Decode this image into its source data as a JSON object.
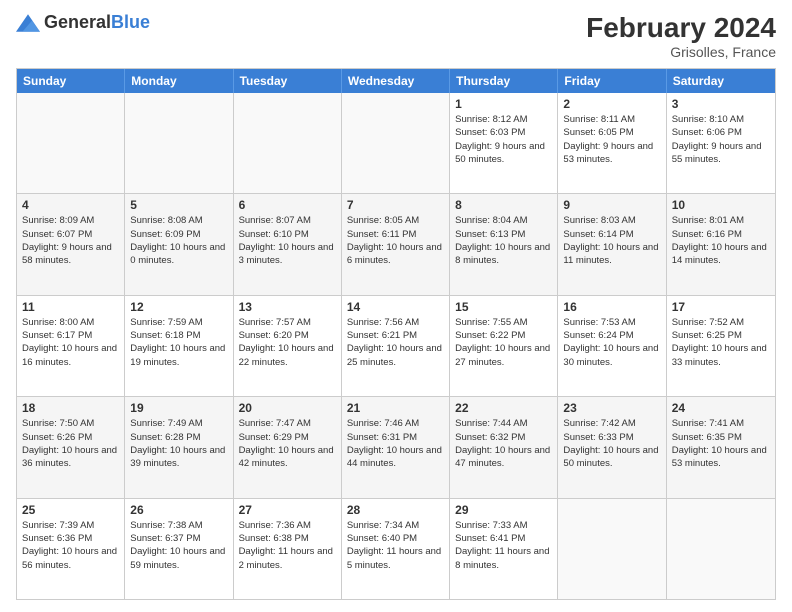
{
  "header": {
    "logo_general": "General",
    "logo_blue": "Blue",
    "month_year": "February 2024",
    "location": "Grisolles, France"
  },
  "days_of_week": [
    "Sunday",
    "Monday",
    "Tuesday",
    "Wednesday",
    "Thursday",
    "Friday",
    "Saturday"
  ],
  "weeks": [
    [
      {
        "day": "",
        "info": ""
      },
      {
        "day": "",
        "info": ""
      },
      {
        "day": "",
        "info": ""
      },
      {
        "day": "",
        "info": ""
      },
      {
        "day": "1",
        "info": "Sunrise: 8:12 AM\nSunset: 6:03 PM\nDaylight: 9 hours and 50 minutes."
      },
      {
        "day": "2",
        "info": "Sunrise: 8:11 AM\nSunset: 6:05 PM\nDaylight: 9 hours and 53 minutes."
      },
      {
        "day": "3",
        "info": "Sunrise: 8:10 AM\nSunset: 6:06 PM\nDaylight: 9 hours and 55 minutes."
      }
    ],
    [
      {
        "day": "4",
        "info": "Sunrise: 8:09 AM\nSunset: 6:07 PM\nDaylight: 9 hours and 58 minutes."
      },
      {
        "day": "5",
        "info": "Sunrise: 8:08 AM\nSunset: 6:09 PM\nDaylight: 10 hours and 0 minutes."
      },
      {
        "day": "6",
        "info": "Sunrise: 8:07 AM\nSunset: 6:10 PM\nDaylight: 10 hours and 3 minutes."
      },
      {
        "day": "7",
        "info": "Sunrise: 8:05 AM\nSunset: 6:11 PM\nDaylight: 10 hours and 6 minutes."
      },
      {
        "day": "8",
        "info": "Sunrise: 8:04 AM\nSunset: 6:13 PM\nDaylight: 10 hours and 8 minutes."
      },
      {
        "day": "9",
        "info": "Sunrise: 8:03 AM\nSunset: 6:14 PM\nDaylight: 10 hours and 11 minutes."
      },
      {
        "day": "10",
        "info": "Sunrise: 8:01 AM\nSunset: 6:16 PM\nDaylight: 10 hours and 14 minutes."
      }
    ],
    [
      {
        "day": "11",
        "info": "Sunrise: 8:00 AM\nSunset: 6:17 PM\nDaylight: 10 hours and 16 minutes."
      },
      {
        "day": "12",
        "info": "Sunrise: 7:59 AM\nSunset: 6:18 PM\nDaylight: 10 hours and 19 minutes."
      },
      {
        "day": "13",
        "info": "Sunrise: 7:57 AM\nSunset: 6:20 PM\nDaylight: 10 hours and 22 minutes."
      },
      {
        "day": "14",
        "info": "Sunrise: 7:56 AM\nSunset: 6:21 PM\nDaylight: 10 hours and 25 minutes."
      },
      {
        "day": "15",
        "info": "Sunrise: 7:55 AM\nSunset: 6:22 PM\nDaylight: 10 hours and 27 minutes."
      },
      {
        "day": "16",
        "info": "Sunrise: 7:53 AM\nSunset: 6:24 PM\nDaylight: 10 hours and 30 minutes."
      },
      {
        "day": "17",
        "info": "Sunrise: 7:52 AM\nSunset: 6:25 PM\nDaylight: 10 hours and 33 minutes."
      }
    ],
    [
      {
        "day": "18",
        "info": "Sunrise: 7:50 AM\nSunset: 6:26 PM\nDaylight: 10 hours and 36 minutes."
      },
      {
        "day": "19",
        "info": "Sunrise: 7:49 AM\nSunset: 6:28 PM\nDaylight: 10 hours and 39 minutes."
      },
      {
        "day": "20",
        "info": "Sunrise: 7:47 AM\nSunset: 6:29 PM\nDaylight: 10 hours and 42 minutes."
      },
      {
        "day": "21",
        "info": "Sunrise: 7:46 AM\nSunset: 6:31 PM\nDaylight: 10 hours and 44 minutes."
      },
      {
        "day": "22",
        "info": "Sunrise: 7:44 AM\nSunset: 6:32 PM\nDaylight: 10 hours and 47 minutes."
      },
      {
        "day": "23",
        "info": "Sunrise: 7:42 AM\nSunset: 6:33 PM\nDaylight: 10 hours and 50 minutes."
      },
      {
        "day": "24",
        "info": "Sunrise: 7:41 AM\nSunset: 6:35 PM\nDaylight: 10 hours and 53 minutes."
      }
    ],
    [
      {
        "day": "25",
        "info": "Sunrise: 7:39 AM\nSunset: 6:36 PM\nDaylight: 10 hours and 56 minutes."
      },
      {
        "day": "26",
        "info": "Sunrise: 7:38 AM\nSunset: 6:37 PM\nDaylight: 10 hours and 59 minutes."
      },
      {
        "day": "27",
        "info": "Sunrise: 7:36 AM\nSunset: 6:38 PM\nDaylight: 11 hours and 2 minutes."
      },
      {
        "day": "28",
        "info": "Sunrise: 7:34 AM\nSunset: 6:40 PM\nDaylight: 11 hours and 5 minutes."
      },
      {
        "day": "29",
        "info": "Sunrise: 7:33 AM\nSunset: 6:41 PM\nDaylight: 11 hours and 8 minutes."
      },
      {
        "day": "",
        "info": ""
      },
      {
        "day": "",
        "info": ""
      }
    ]
  ]
}
